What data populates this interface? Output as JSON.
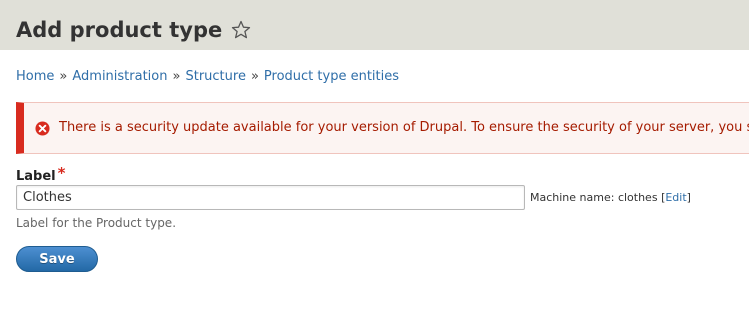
{
  "header": {
    "title": "Add product type",
    "shortcut_icon": "star-outline-icon"
  },
  "breadcrumb": {
    "items": [
      "Home",
      "Administration",
      "Structure",
      "Product type entities"
    ],
    "separator": "»"
  },
  "message": {
    "type": "error",
    "icon": "error-circle-icon",
    "text": "There is a security update available for your version of Drupal. To ensure the security of your server, you should update immediately!"
  },
  "form": {
    "label_field": {
      "label": "Label",
      "required_mark": "*",
      "value": "Clothes",
      "description": "Label for the Product type."
    },
    "machine_name": {
      "prefix": "Machine name: clothes",
      "open_bracket": "[",
      "edit_link": "Edit",
      "close_bracket": "]"
    },
    "save_label": "Save"
  },
  "colors": {
    "header_bg": "#e0e0d8",
    "link": "#2f6ea8",
    "error_border": "#d82b1f",
    "error_text": "#a51b00",
    "button_bg": "#2369a6"
  }
}
